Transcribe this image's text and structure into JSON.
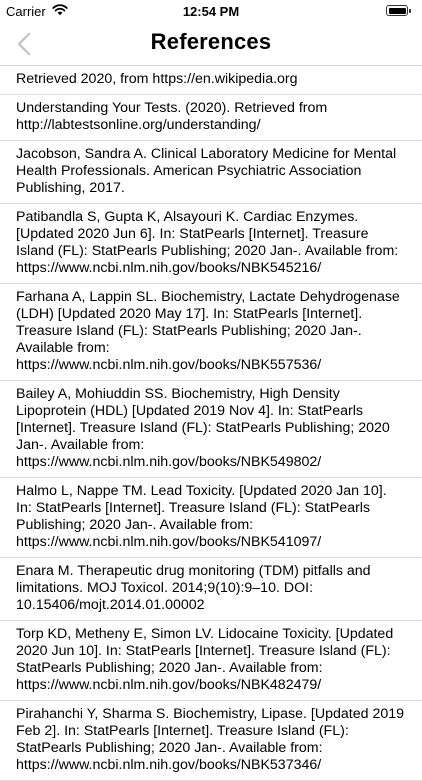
{
  "status_bar": {
    "carrier": "Carrier",
    "time": "12:54 PM"
  },
  "nav": {
    "title": "References",
    "back_icon": "chevron-left-icon"
  },
  "references": [
    "Retrieved 2020, from https://en.wikipedia.org",
    "Understanding Your Tests. (2020). Retrieved from http://labtestsonline.org/understanding/",
    "Jacobson, Sandra A. Clinical Laboratory Medicine for Mental Health Professionals. American Psychiatric Association Publishing, 2017.",
    "Patibandla S, Gupta K, Alsayouri K. Cardiac Enzymes. [Updated 2020 Jun 6]. In: StatPearls [Internet]. Treasure Island (FL): StatPearls Publishing; 2020 Jan-. Available from: https://www.ncbi.nlm.nih.gov/books/NBK545216/",
    "Farhana A, Lappin SL. Biochemistry, Lactate Dehydrogenase (LDH) [Updated 2020 May 17]. In: StatPearls [Internet]. Treasure Island (FL): StatPearls Publishing; 2020 Jan-. Available from: https://www.ncbi.nlm.nih.gov/books/NBK557536/",
    "Bailey A, Mohiuddin SS. Biochemistry, High Density Lipoprotein (HDL) [Updated 2019 Nov 4]. In: StatPearls [Internet]. Treasure Island (FL): StatPearls Publishing; 2020 Jan-. Available from: https://www.ncbi.nlm.nih.gov/books/NBK549802/",
    "Halmo L, Nappe TM. Lead Toxicity. [Updated 2020 Jan 10]. In: StatPearls [Internet]. Treasure Island (FL): StatPearls Publishing; 2020 Jan-. Available from: https://www.ncbi.nlm.nih.gov/books/NBK541097/",
    " Enara M. Therapeutic drug monitoring (TDM) pitfalls and limitations. MOJ Toxicol. 2014;9(10):9–10. DOI: 10.15406/mojt.2014.01.00002",
    "Torp KD, Metheny E, Simon LV. Lidocaine Toxicity. [Updated 2020 Jun 10]. In: StatPearls [Internet]. Treasure Island (FL): StatPearls Publishing; 2020 Jan-. Available from: https://www.ncbi.nlm.nih.gov/books/NBK482479/",
    "Pirahanchi Y, Sharma S. Biochemistry, Lipase. [Updated 2019 Feb 2]. In: StatPearls [Internet]. Treasure Island (FL): StatPearls Publishing; 2020 Jan-. Available from: https://www.ncbi.nlm.nih.gov/books/NBK537346/"
  ],
  "colors": {
    "back_chevron": "#c7c7cc",
    "separator": "#dcdcdc"
  }
}
